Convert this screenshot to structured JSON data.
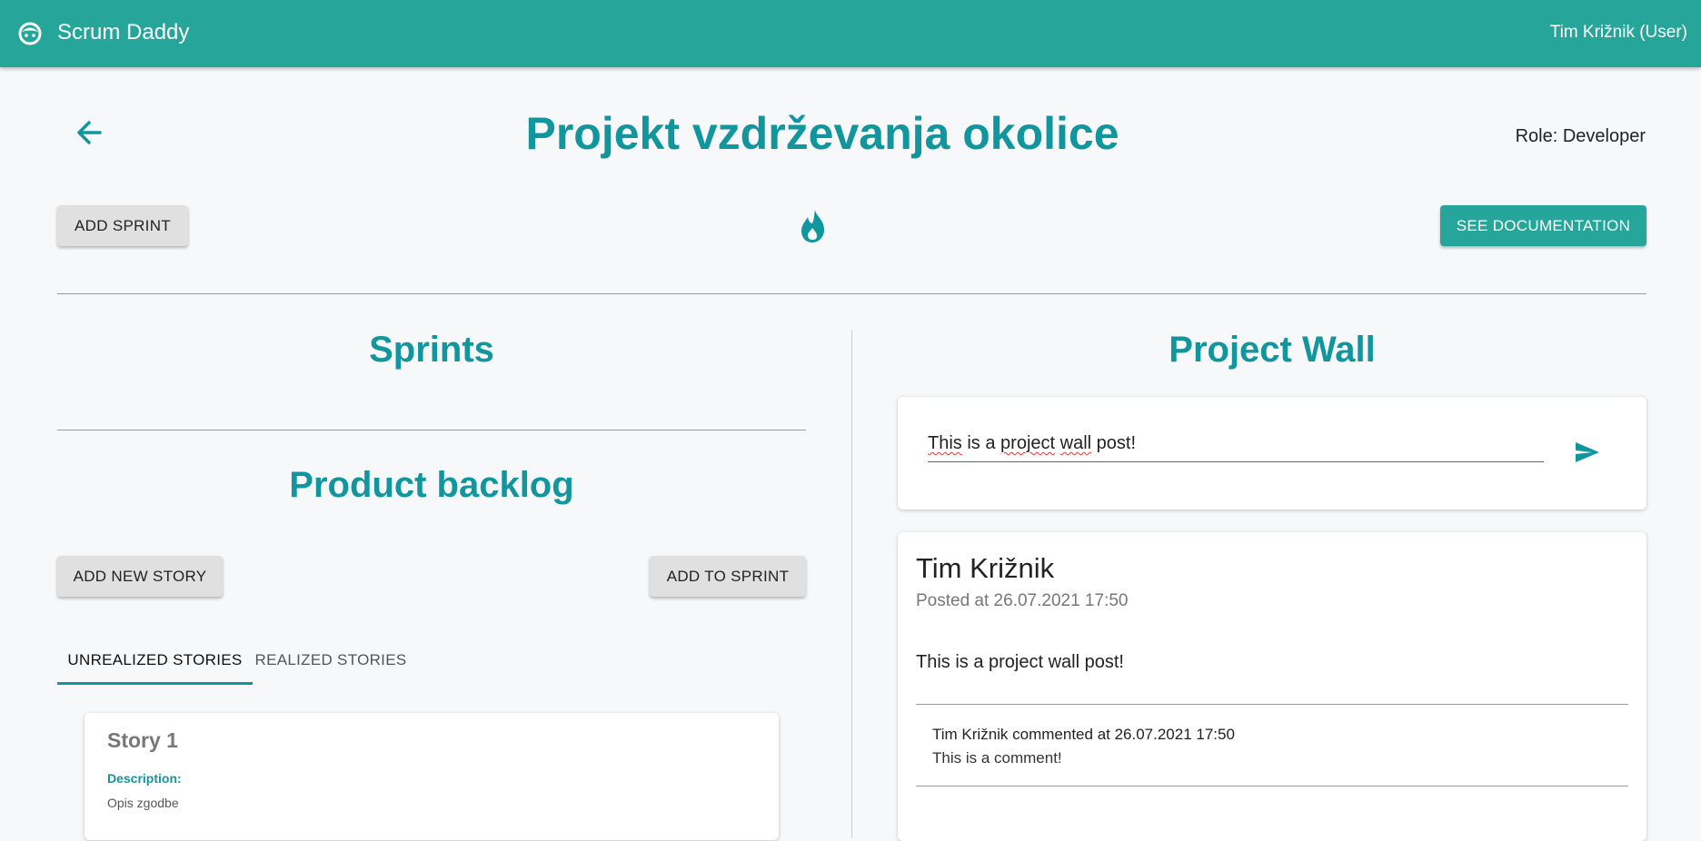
{
  "appbar": {
    "brand": "Scrum Daddy",
    "user": "Tim Križnik (User)",
    "logo_icon": "face-icon",
    "color": "#26a69a"
  },
  "header": {
    "back_icon": "arrow-left-icon",
    "title": "Projekt vzdrževanja okolice",
    "role": "Role: Developer"
  },
  "toolbar": {
    "add_sprint_label": "Add sprint",
    "flame_icon": "flame-icon",
    "see_documentation_label": "See documentation"
  },
  "sprints": {
    "title": "Sprints"
  },
  "backlog": {
    "title": "Product backlog",
    "add_new_story_label": "Add new story",
    "add_to_sprint_label": "Add to sprint",
    "tabs": [
      {
        "label": "Unrealized stories",
        "active": true
      },
      {
        "label": "Realized stories",
        "active": false
      }
    ],
    "stories": [
      {
        "title": "Story 1",
        "description_label": "Description:",
        "description": "Opis zgodbe"
      }
    ]
  },
  "wall": {
    "title": "Project Wall",
    "input": {
      "value_words": [
        "This",
        " is a ",
        "project",
        " ",
        "wall",
        " post!"
      ],
      "send_icon": "send-icon"
    },
    "posts": [
      {
        "author": "Tim Križnik",
        "posted_at": "Posted at 26.07.2021 17:50",
        "body": "This is a project wall post!",
        "comments": [
          {
            "meta": "Tim Križnik commented at 26.07.2021 17:50",
            "text": "This is a comment!"
          }
        ]
      }
    ]
  },
  "colors": {
    "accent": "#11969e",
    "brand": "#26a69a",
    "background": "#f7f8fa"
  }
}
